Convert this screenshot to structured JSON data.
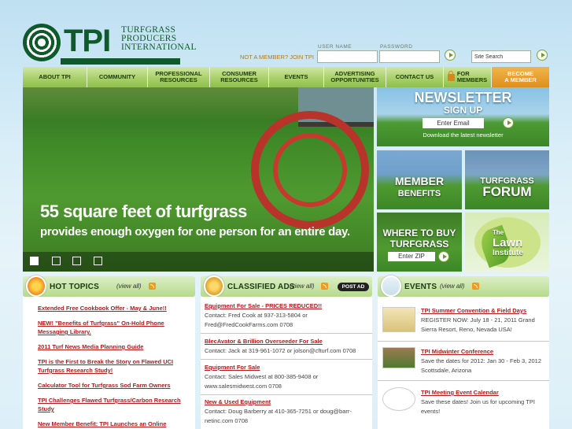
{
  "brand": {
    "logo_text": "TPI",
    "logo_sub_1": "TURFGRASS",
    "logo_sub_2": "PRODUCERS",
    "logo_sub_3": "INTERNATIONAL",
    "color_primary": "#0f5a2a",
    "color_accent": "#e08f1f",
    "color_link": "#b01c1c"
  },
  "login": {
    "username_label": "USER NAME",
    "password_label": "PASSWORD",
    "not_member": "NOT A MEMBER? JOIN TPI",
    "search_value": "Site Search"
  },
  "nav": [
    {
      "line1": "ABOUT TPI",
      "line2": ""
    },
    {
      "line1": "COMMUNITY",
      "line2": ""
    },
    {
      "line1": "PROFESSIONAL",
      "line2": "RESOURCES"
    },
    {
      "line1": "CONSUMER",
      "line2": "RESOURCES"
    },
    {
      "line1": "EVENTS",
      "line2": ""
    },
    {
      "line1": "ADVERTISING",
      "line2": "OPPORTUNITIES"
    },
    {
      "line1": "CONTACT US",
      "line2": ""
    },
    {
      "line1": "FOR",
      "line2": "MEMBERS"
    },
    {
      "line1": "BECOME",
      "line2": "A MEMBER"
    }
  ],
  "hero": {
    "headline": "55 square feet of turfgrass",
    "subline": "provides enough oxygen for one person for an entire day.",
    "slides_total": 4,
    "slide_active": 1
  },
  "tiles": {
    "newsletter_title": "NEWSLETTER",
    "newsletter_sub": "SIGN UP",
    "newsletter_placeholder": "Enter Email",
    "newsletter_link": "Download the latest newsletter",
    "benefits_1": "MEMBER",
    "benefits_2": "BENEFITS",
    "forum_1": "TURFGRASS",
    "forum_2": "FORUM",
    "wtb_1": "WHERE TO BUY",
    "wtb_2": "TURFGRASS",
    "wtb_placeholder": "Enter ZIP",
    "lawn_1": "The",
    "lawn_2": "Lawn",
    "lawn_3": "Institute"
  },
  "hot_topics": {
    "title": "HOT TOPICS",
    "view_all": "(view all)",
    "items": [
      {
        "l1": "Extended Free Cookbook Offer - May & June!!",
        "l2": ""
      },
      {
        "l1": "NEW! \"Benefits of Turfgrass\" On-Hold Phone",
        "l2": "Messaging Library."
      },
      {
        "l1": "2011 Turf News Media Planning Guide",
        "l2": ""
      },
      {
        "l1": "TPI is the First to Break the Story on Flawed UCI",
        "l2": "Turfgrass Research Study!"
      },
      {
        "l1": "Calculator Tool for Turfgrass Sod Farm Owners",
        "l2": ""
      },
      {
        "l1": "TPI Challenges Flawed Turfgrass/Carbon Research",
        "l2": "Study"
      },
      {
        "l1": "New Member Benefit: TPI Launches an Online",
        "l2": ""
      }
    ]
  },
  "classified": {
    "title": "CLASSIFIED ADS",
    "view_all": "(view all)",
    "post_ad": "POST AD",
    "items": [
      {
        "title": "Equipment For Sale - PRICES REDUCED!!",
        "l1": "Contact: Fred Cook at 937-313-5804 or",
        "l2": "Fred@FredCookFarms.com 0708"
      },
      {
        "title": "BlecAvator & Brillion Overseeder For Sale",
        "l1": "Contact: Jack at 319-961-1072 or jolson@cfturf.com 0708",
        "l2": ""
      },
      {
        "title": "Equipment For Sale",
        "l1": "Contact: Sales Midwest at 800-385-9408 or",
        "l2": "www.salesmidwest.com 0708"
      },
      {
        "title": "New & Used Equipment",
        "l1": "Contact: Doug Barberry at 410-365-7251 or doug@barr-",
        "l2": "netinc.com 0708"
      }
    ]
  },
  "events": {
    "title": "EVENTS",
    "view_all": "(view all)",
    "items": [
      {
        "title": "TPI Summer Convention & Field Days",
        "l1": "REGISTER NOW: July 18 - 21, 2011 Grand",
        "l2": "Sierra Resort, Reno, Nevada USA!"
      },
      {
        "title": "TPI Midwinter Conference",
        "l1": "Save the dates for 2012: Jan 30 - Feb 3, 2012",
        "l2": "Scottsdale, Arizona"
      },
      {
        "title": "TPI Meeting Event Calendar",
        "l1": "Save these dates! Join us for upcoming TPI",
        "l2": "events!"
      }
    ]
  }
}
